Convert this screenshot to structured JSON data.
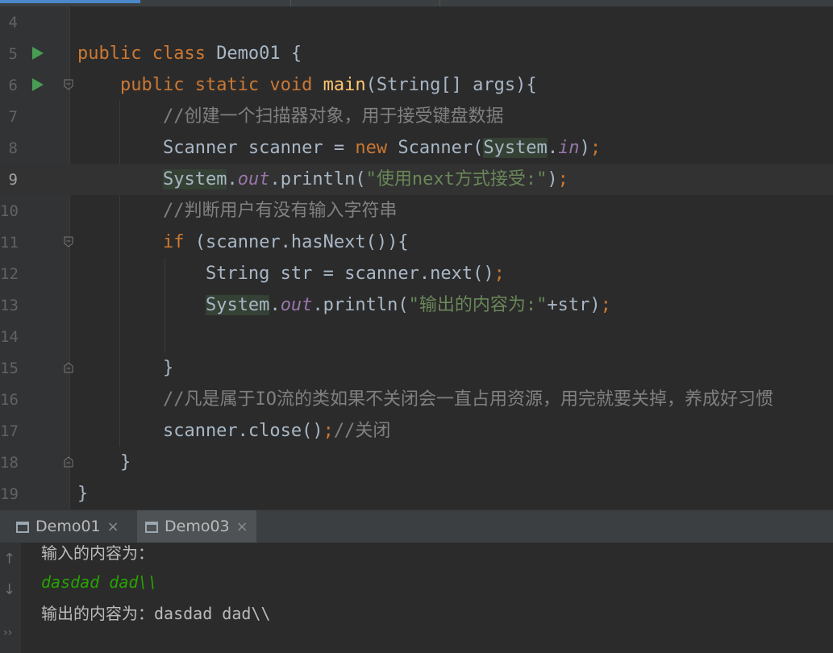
{
  "editor": {
    "lines": [
      {
        "n": "4"
      },
      {
        "n": "5",
        "run": true,
        "t": [
          [
            "kw",
            "public class "
          ],
          [
            "",
            "Demo01 {"
          ]
        ]
      },
      {
        "n": "6",
        "run": true,
        "fold": "open",
        "t": [
          [
            "",
            "    "
          ],
          [
            "kw",
            "public static void "
          ],
          [
            "fn",
            "main"
          ],
          [
            "",
            "(String[] args){"
          ]
        ]
      },
      {
        "n": "7",
        "t": [
          [
            "",
            "        "
          ],
          [
            "cm",
            "//创建一个扫描器对象，用于接受键盘数据"
          ]
        ]
      },
      {
        "n": "8",
        "t": [
          [
            "",
            "        Scanner scanner = "
          ],
          [
            "kw",
            "new "
          ],
          [
            "",
            "Scanner("
          ],
          [
            "hl",
            "System"
          ],
          [
            "",
            "."
          ],
          [
            "fld",
            "in"
          ],
          [
            "",
            ")"
          ],
          [
            "kw",
            ";"
          ]
        ]
      },
      {
        "n": "9",
        "current": true,
        "t": [
          [
            "",
            "        "
          ],
          [
            "hl",
            "System"
          ],
          [
            "",
            "."
          ],
          [
            "fld",
            "out"
          ],
          [
            "",
            ".println("
          ],
          [
            "str",
            "\"使用next方式接受:\""
          ],
          [
            "",
            ")"
          ],
          [
            "kw",
            ";"
          ]
        ]
      },
      {
        "n": "10",
        "t": [
          [
            "",
            "        "
          ],
          [
            "cm",
            "//判断用户有没有输入字符串"
          ]
        ]
      },
      {
        "n": "11",
        "fold": "open",
        "t": [
          [
            "",
            "        "
          ],
          [
            "kw",
            "if "
          ],
          [
            "",
            "(scanner.hasNext()){"
          ]
        ]
      },
      {
        "n": "12",
        "t": [
          [
            "",
            "            String str = scanner.next()"
          ],
          [
            "kw",
            ";"
          ]
        ]
      },
      {
        "n": "13",
        "t": [
          [
            "",
            "            "
          ],
          [
            "hl",
            "System"
          ],
          [
            "",
            "."
          ],
          [
            "fld",
            "out"
          ],
          [
            "",
            ".println("
          ],
          [
            "str",
            "\"输出的内容为:\""
          ],
          [
            "",
            "+str)"
          ],
          [
            "kw",
            ";"
          ]
        ]
      },
      {
        "n": "14"
      },
      {
        "n": "15",
        "fold": "close",
        "t": [
          [
            "",
            "        }"
          ]
        ]
      },
      {
        "n": "16",
        "t": [
          [
            "",
            "        "
          ],
          [
            "cm",
            "//凡是属于IO流的类如果不关闭会一直占用资源，用完就要关掉，养成好习惯"
          ]
        ]
      },
      {
        "n": "17",
        "t": [
          [
            "",
            "        scanner.close()"
          ],
          [
            "kw",
            ";"
          ],
          [
            "cm",
            "//关闭"
          ]
        ]
      },
      {
        "n": "18",
        "fold": "close",
        "t": [
          [
            "",
            "    }"
          ]
        ]
      },
      {
        "n": "19",
        "t": [
          [
            "",
            "}"
          ]
        ]
      }
    ]
  },
  "panel": {
    "tabs": [
      {
        "label": "Demo01",
        "close": "×"
      },
      {
        "label": "Demo03",
        "close": "×"
      }
    ]
  },
  "console": {
    "line1": "输入的内容为：",
    "line2": "dasdad dad\\\\",
    "line3": "输出的内容为：dasdad dad\\\\",
    "up_icon": "↑",
    "down_icon": "↓",
    "more_icon": "››"
  }
}
